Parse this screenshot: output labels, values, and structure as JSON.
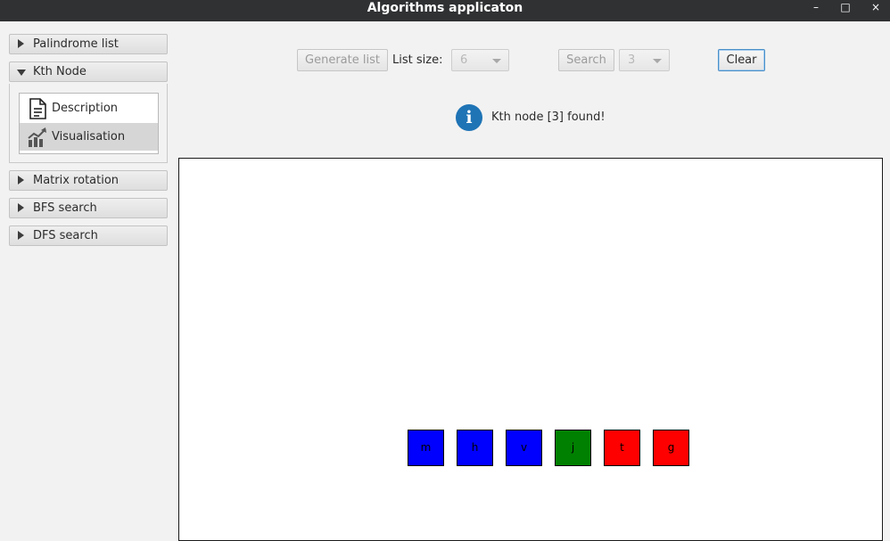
{
  "window": {
    "title": "Algorithms applicaton",
    "minimize_glyph": "–",
    "maximize_glyph": "□",
    "close_glyph": "×"
  },
  "sidebar": {
    "sections": [
      {
        "label": "Palindrome list",
        "expanded": false
      },
      {
        "label": "Kth Node",
        "expanded": true,
        "items": [
          {
            "label": "Description",
            "icon": "document-icon",
            "selected": false
          },
          {
            "label": "Visualisation",
            "icon": "chart-line-icon",
            "selected": true
          }
        ]
      },
      {
        "label": "Matrix rotation",
        "expanded": false
      },
      {
        "label": "BFS search",
        "expanded": false
      },
      {
        "label": "DFS search",
        "expanded": false
      }
    ]
  },
  "toolbar": {
    "generate_label": "Generate list",
    "list_size_label": "List size:",
    "list_size_value": "6",
    "search_label": "Search",
    "search_value": "3",
    "clear_label": "Clear"
  },
  "info": {
    "icon": "info-icon",
    "glyph": "i",
    "message": "Kth node [3] found!"
  },
  "visualisation": {
    "nodes": [
      {
        "label": "m",
        "color": "#0000ff"
      },
      {
        "label": "h",
        "color": "#0000ff"
      },
      {
        "label": "v",
        "color": "#0000ff"
      },
      {
        "label": "j",
        "color": "#008000"
      },
      {
        "label": "t",
        "color": "#ff0000"
      },
      {
        "label": "g",
        "color": "#ff0000"
      }
    ]
  }
}
